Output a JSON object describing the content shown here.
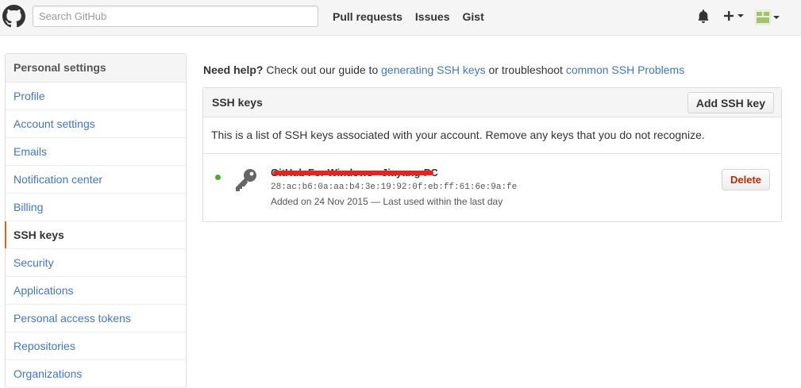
{
  "header": {
    "logo_icon": "github-octocat-icon",
    "search_placeholder": "Search GitHub",
    "nav": [
      {
        "label": "Pull requests"
      },
      {
        "label": "Issues"
      },
      {
        "label": "Gist"
      }
    ],
    "notifications_icon": "bell-icon",
    "create_icon": "plus-icon",
    "avatar_icon": "avatar-icon"
  },
  "sidebar": {
    "title": "Personal settings",
    "items": [
      {
        "label": "Profile"
      },
      {
        "label": "Account settings"
      },
      {
        "label": "Emails"
      },
      {
        "label": "Notification center"
      },
      {
        "label": "Billing"
      },
      {
        "label": "SSH keys",
        "selected": true
      },
      {
        "label": "Security"
      },
      {
        "label": "Applications"
      },
      {
        "label": "Personal access tokens"
      },
      {
        "label": "Repositories"
      },
      {
        "label": "Organizations"
      }
    ]
  },
  "help": {
    "lead": "Need help?",
    "text1": " Check out our guide to ",
    "link1": "generating SSH keys",
    "text2": " or troubleshoot ",
    "link2": "common SSH Problems"
  },
  "ssh": {
    "title": "SSH keys",
    "add_label": "Add SSH key",
    "description": "This is a list of SSH keys associated with your account. Remove any keys that you do not recognize.",
    "keys": [
      {
        "title": "GitHub For Windows - Jiayang-PC",
        "fingerprint": "28:ac:b6:0a:aa:b4:3e:19:92:0f:eb:ff:61:6e:9a:fe",
        "added": "Added on 24 Nov 2015 — Last used within the last day",
        "delete_label": "Delete",
        "icon": "key-icon"
      }
    ]
  },
  "colors": {
    "link": "#4078c0",
    "accent": "#d26911",
    "danger": "#bd2c00",
    "active_dot": "#55a532",
    "redaction": "#e8231b"
  }
}
